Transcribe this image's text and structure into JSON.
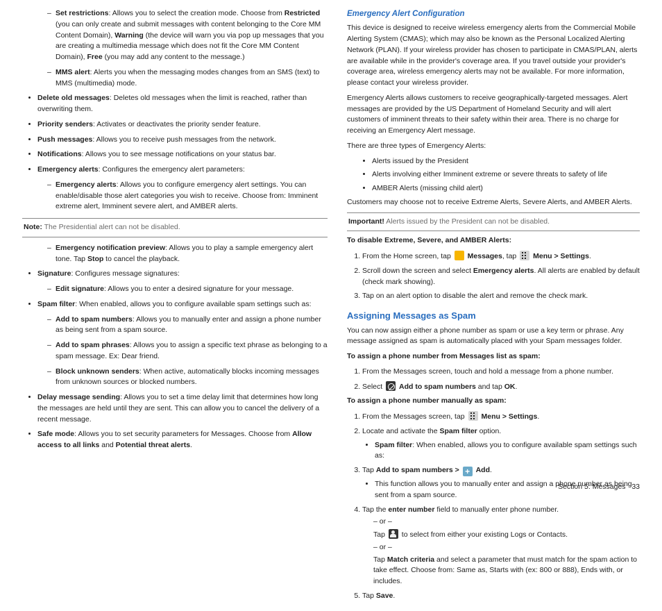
{
  "left": {
    "sub1": [
      {
        "t": "Set restrictions",
        "d": ": Allows you to select the creation mode. Choose from ",
        "b1": "Restricted",
        "d2": " (you can only create and submit messages with content belonging to the Core MM Content Domain), ",
        "b2": "Warning",
        "d3": " (the device will warn you via pop up messages that you are creating a multimedia message which does not fit the Core MM Content Domain), ",
        "b3": "Free",
        "d4": " (you may add any content to the message.)"
      },
      {
        "t": "MMS alert",
        "d": ": Alerts you when the messaging modes changes from an SMS (text) to MMS (multimedia) mode."
      }
    ],
    "bul1": [
      {
        "t": "Delete old messages",
        "d": ": Deletes old messages when the limit is reached, rather than overwriting them."
      },
      {
        "t": "Priority senders",
        "d": ": Activates or deactivates the priority sender feature."
      },
      {
        "t": "Push messages",
        "d": ": Allows you to receive push messages from the network."
      },
      {
        "t": "Notifications",
        "d": ": Allows you to see message notifications on your status bar."
      },
      {
        "t": "Emergency alerts",
        "d": ": Configures the emergency alert parameters:"
      }
    ],
    "sub2": [
      {
        "t": "Emergency alerts",
        "d": ": Allows you to configure emergency alert settings. You can enable/disable those alert categories you wish to receive. Choose from: Imminent extreme alert, Imminent severe alert, and AMBER alerts."
      }
    ],
    "note_label": "Note:",
    "note": " The Presidential alert can not be disabled.",
    "sub3": [
      {
        "t": "Emergency notification preview",
        "d": ": Allows you to play a sample emergency alert tone. Tap ",
        "b1": "Stop",
        "d2": " to cancel the playback."
      }
    ],
    "bul2": [
      {
        "t": "Signature",
        "d": ": Configures message signatures:"
      }
    ],
    "sub4": [
      {
        "t": "Edit signature",
        "d": ": Allows you to enter a desired signature for your message."
      }
    ],
    "bul3": [
      {
        "t": "Spam filter",
        "d": ": When enabled, allows you to configure available spam settings such as:"
      }
    ],
    "sub5": [
      {
        "t": "Add to spam numbers",
        "d": ": Allows you to manually enter and assign a phone number as being sent from a spam source."
      },
      {
        "t": "Add to spam phrases",
        "d": ": Allows you to assign a specific text phrase as belonging to a spam message. Ex: Dear friend."
      },
      {
        "t": "Block unknown senders",
        "d": ": When active, automatically blocks incoming messages from unknown sources or blocked numbers."
      }
    ],
    "bul4": [
      {
        "t": "Delay message sending",
        "d": ": Allows you to set a time delay limit that determines how long the messages are held until they are sent. This can allow you to cancel the delivery of a recent message."
      },
      {
        "t": "Safe mode",
        "d": ": Allows you to set security parameters for Messages. Choose from ",
        "b1": "Allow access to all links",
        "d2": " and ",
        "b2": "Potential threat alerts",
        "d3": "."
      }
    ]
  },
  "right": {
    "hdr_emerg": "Emergency Alert Configuration",
    "emerg_p1": "This device is designed to receive wireless emergency alerts from the Commercial Mobile Alerting System (CMAS); which may also be known as the Personal Localized Alerting Network (PLAN). If your wireless provider has chosen to participate in CMAS/PLAN, alerts are available while in the provider's coverage area. If you travel outside your provider's coverage area, wireless emergency alerts may not be available. For more information, please contact your wireless provider.",
    "emerg_p2": "Emergency Alerts allows customers to receive geographically-targeted messages. Alert messages are provided by the US Department of Homeland Security and will alert customers of imminent threats to their safety within their area. There is no charge for receiving an Emergency Alert message.",
    "emerg_p3": "There are three types of Emergency Alerts:",
    "emerg_bul": [
      "Alerts issued by the President",
      "Alerts involving either Imminent extreme or severe threats to safety of life",
      "AMBER Alerts (missing child alert)"
    ],
    "emerg_p4": "Customers may choose not to receive Extreme Alerts, Severe Alerts, and AMBER Alerts.",
    "imp_label": "Important!",
    "imp": " Alerts issued by the President can not be disabled.",
    "disable_hdr": "To disable Extreme, Severe, and AMBER Alerts:",
    "dis1_a": "From the Home screen, tap ",
    "dis1_msgs": "Messages",
    "dis1_b": ", tap ",
    "dis1_menu": "Menu > Settings",
    "dis1_c": ".",
    "dis2_a": "Scroll down the screen and select ",
    "dis2_b": "Emergency alerts",
    "dis2_c": ". All alerts are enabled by default (check mark showing).",
    "dis3": "Tap on an alert option to disable the alert and remove the check mark.",
    "hdr_spam": "Assigning Messages as Spam",
    "spam_p1": "You can now assign either a phone number as spam or use a key term or phrase. Any message assigned as spam is automatically placed with your Spam messages folder.",
    "assign_list_hdr": "To assign a phone number from Messages list as spam:",
    "al1": "From the Messages screen, touch and hold a message from a phone number.",
    "al2_a": "Select ",
    "al2_b": "Add to spam numbers",
    "al2_c": " and tap ",
    "al2_d": "OK",
    "al2_e": ".",
    "assign_man_hdr": "To assign a phone number manually as spam:",
    "am1_a": "From the Messages screen, tap ",
    "am1_menu": "Menu > Settings",
    "am1_b": ".",
    "am2_a": "Locate and activate the ",
    "am2_b": "Spam filter",
    "am2_c": " option.",
    "am2_sub_t": "Spam filter",
    "am2_sub_d": ": When enabled, allows you to configure available spam settings such as:",
    "am3_a": "Tap ",
    "am3_b": "Add to spam numbers > ",
    "am3_c": "Add",
    "am3_d": ".",
    "am3_sub": "This function allows you to manually enter and assign a phone number as being sent from a spam source.",
    "am4_a": "Tap the ",
    "am4_b": "enter number",
    "am4_c": " field to manually enter phone number.",
    "or": "– or –",
    "am4_sub_a": "Tap ",
    "am4_sub_b": " to select from either your existing Logs or Contacts.",
    "am4_sub2_a": "Tap ",
    "am4_sub2_b": "Match criteria",
    "am4_sub2_c": " and select a parameter that must match for the spam action to take effect. Choose from: Same as, Starts with (ex: 800 or 888), Ends with, or includes.",
    "am5_a": "Tap ",
    "am5_b": "Save",
    "am5_c": "."
  },
  "footer": {
    "section": "Section 5:  Messages",
    "page": "33"
  }
}
